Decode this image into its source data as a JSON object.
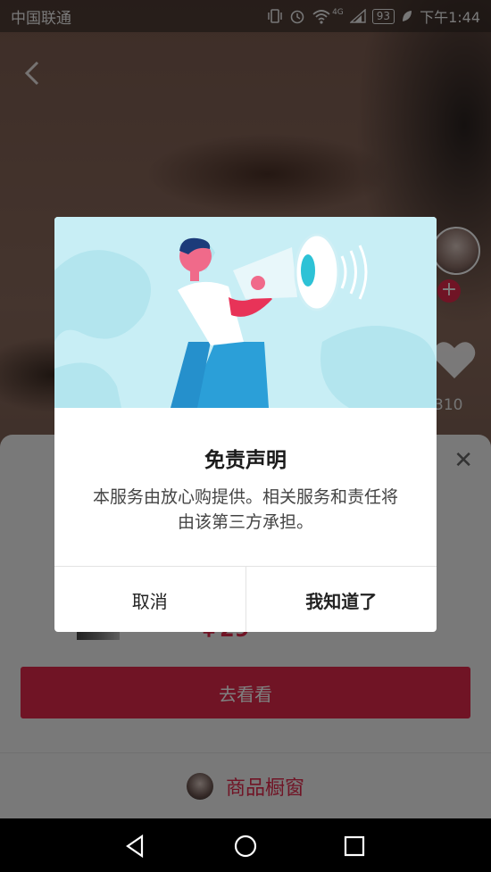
{
  "status_bar": {
    "carrier": "中国联通",
    "network": "4G",
    "battery": "93",
    "time": "下午1:44"
  },
  "video": {
    "like_count": "310"
  },
  "product_panel": {
    "price": "￥29",
    "go_button_label": "去看看",
    "shop_window_label": "商品橱窗"
  },
  "dialog": {
    "title": "免责声明",
    "body": "本服务由放心购提供。相关服务和责任将由该第三方承担。",
    "cancel_label": "取消",
    "confirm_label": "我知道了"
  },
  "colors": {
    "accent": "#e0284a",
    "illustration_bg": "#c8eef5"
  },
  "icons": [
    "back-icon",
    "vibrate-icon",
    "alarm-icon",
    "wifi-icon",
    "signal-icon",
    "leaf-icon",
    "heart-icon",
    "plus-icon",
    "close-icon",
    "megaphone-icon",
    "nav-back-icon",
    "nav-home-icon",
    "nav-recents-icon"
  ]
}
